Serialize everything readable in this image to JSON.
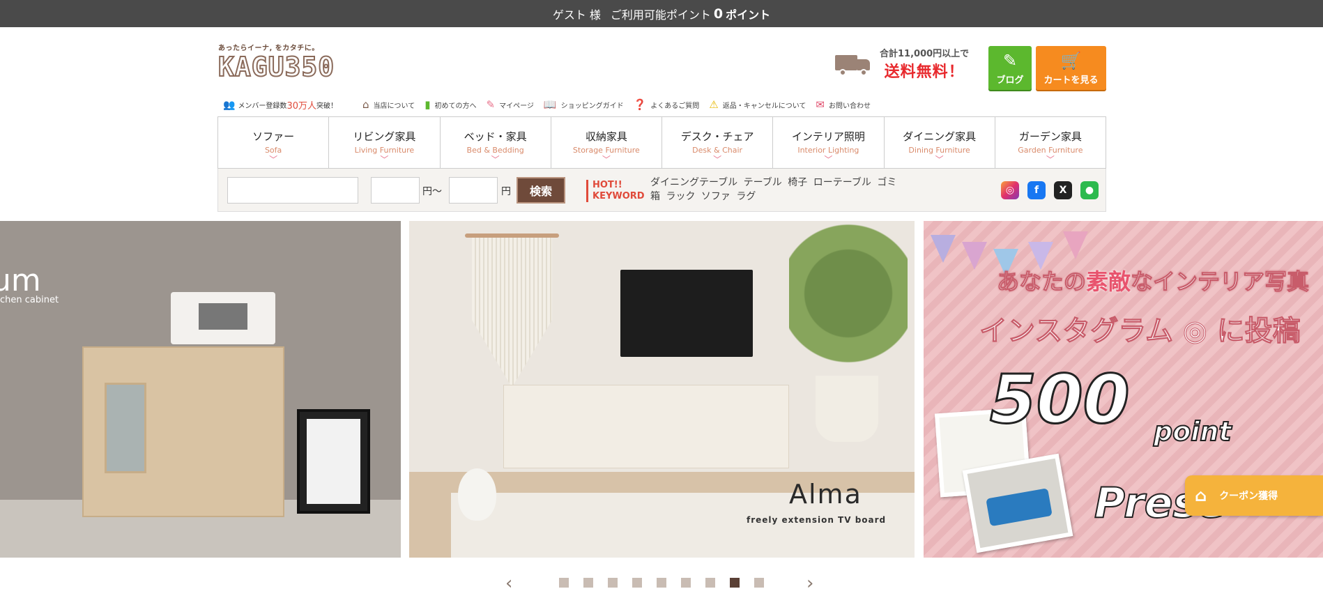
{
  "topbar": {
    "guest": "ゲスト 様",
    "points_label": "ご利用可能ポイント",
    "points_value": "0",
    "points_unit": "ポイント"
  },
  "logo": {
    "tagline": "あったらイーナ, をカタチに。",
    "name": "KAGU350"
  },
  "shipping": {
    "small": "合計11,000円以上で",
    "big": "送料無料！"
  },
  "buttons": {
    "blog": "ブログ",
    "cart": "カートを見る"
  },
  "member": {
    "prefix": "メンバー登録数",
    "count": "30万人",
    "suffix": "突破！"
  },
  "subnav": [
    {
      "label": "当店について",
      "icon": "home-icon"
    },
    {
      "label": "初めての方へ",
      "icon": "beginner-icon"
    },
    {
      "label": "マイページ",
      "icon": "pencil-icon"
    },
    {
      "label": "ショッピングガイド",
      "icon": "book-icon"
    },
    {
      "label": "よくあるご質問",
      "icon": "question-icon"
    },
    {
      "label": "返品・キャンセルについて",
      "icon": "warning-icon"
    },
    {
      "label": "お問い合わせ",
      "icon": "mail-icon"
    }
  ],
  "categories": [
    {
      "jp": "ソファー",
      "en": "Sofa"
    },
    {
      "jp": "リビング家具",
      "en": "Living Furniture"
    },
    {
      "jp": "ベッド・家具",
      "en": "Bed & Bedding"
    },
    {
      "jp": "収納家具",
      "en": "Storage Furniture"
    },
    {
      "jp": "デスク・チェア",
      "en": "Desk & Chair"
    },
    {
      "jp": "インテリア照明",
      "en": "Interior Lighting"
    },
    {
      "jp": "ダイニング家具",
      "en": "Dining Furniture"
    },
    {
      "jp": "ガーデン家具",
      "en": "Garden Furniture"
    }
  ],
  "search": {
    "yen_from": "円～",
    "yen": "円",
    "button": "検索",
    "hot_line1": "HOT!!",
    "hot_line2": "KEYWORD"
  },
  "keywords": [
    "ダイニングテーブル",
    "テーブル",
    "椅子",
    "ローテーブル",
    "ゴミ箱",
    "ラック",
    "ソファ",
    "ラグ"
  ],
  "social": {
    "instagram": "◎",
    "facebook": "f",
    "x": "X",
    "line": "●"
  },
  "slides": {
    "left": {
      "title": "um",
      "sub": "chen cabinet"
    },
    "mid": {
      "title": "Alma",
      "sub": "freely extension TV board"
    },
    "right": {
      "line1_a": "あなたの",
      "line1_accent": "素敵",
      "line1_b": "なインテリア写真",
      "line2": "インスタグラム ◎ に投稿",
      "big": "500",
      "point": "point",
      "present": "Prese"
    }
  },
  "coupon": {
    "label": "クーポン獲得"
  },
  "pager": {
    "prev": "‹",
    "next": "›",
    "dot_count": 9,
    "active_index": 7
  }
}
